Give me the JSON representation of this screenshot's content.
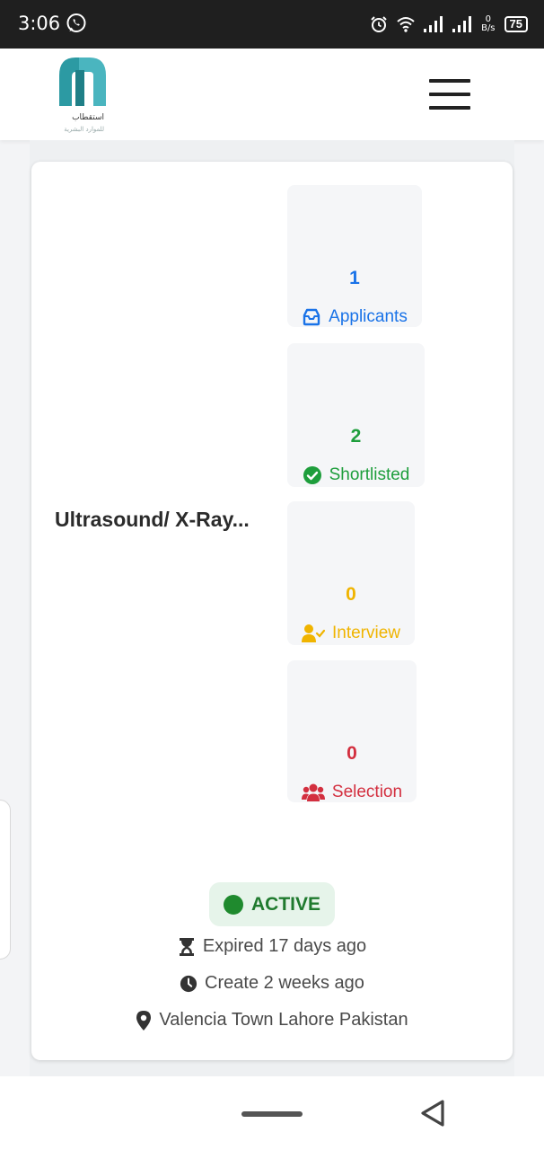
{
  "status_bar": {
    "time": "3:06",
    "whatsapp_icon": "whatsapp-icon",
    "speed_value": "0",
    "speed_unit": "B/s",
    "battery": "75"
  },
  "header": {
    "logo_text_ar": "استقطاب",
    "logo_sub_ar": "للموارد البشرية",
    "menu_icon": "hamburger-menu-icon"
  },
  "job": {
    "title": "Ultrasound/ X-Ray..."
  },
  "stats": [
    {
      "count": "1",
      "label": "Applicants",
      "color": "#1a73e8",
      "icon": "inbox-icon"
    },
    {
      "count": "2",
      "label": "Shortlisted",
      "color": "#1e9e3c",
      "icon": "check-circle-icon"
    },
    {
      "count": "0",
      "label": "Interview",
      "color": "#f0b400",
      "icon": "user-check-icon"
    },
    {
      "count": "0",
      "label": "Selection",
      "color": "#d32f3f",
      "icon": "users-icon"
    }
  ],
  "status": {
    "label": "ACTIVE",
    "color": "#1f8a2e"
  },
  "meta": {
    "expired": "Expired 17 days ago",
    "created": "Create 2 weeks ago",
    "location": "Valencia Town Lahore Pakistan"
  }
}
